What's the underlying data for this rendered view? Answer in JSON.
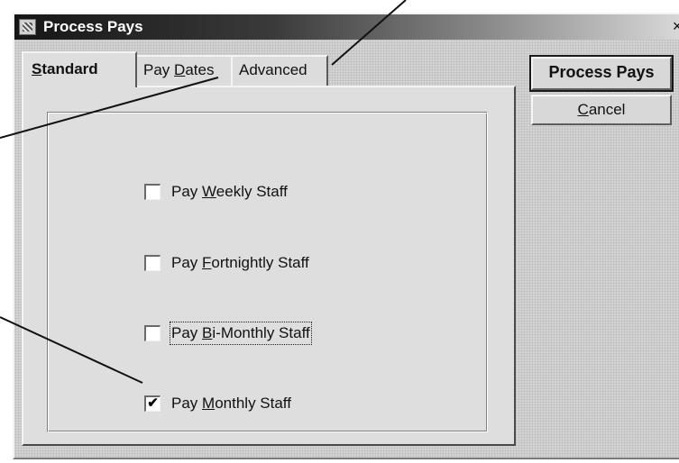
{
  "window": {
    "title": "Process Pays",
    "close_glyph": "×",
    "icon": "app-icon"
  },
  "tabs": [
    {
      "label": "Standard",
      "accel": "S",
      "rest": "tandard",
      "selected": true
    },
    {
      "label": "Pay Dates",
      "pre": "Pay ",
      "accel": "D",
      "rest": "ates",
      "selected": false
    },
    {
      "label": "Advanced",
      "selected": false
    }
  ],
  "options": [
    {
      "pre": "Pay ",
      "accel": "W",
      "rest": "eekly Staff",
      "checked": false
    },
    {
      "pre": "Pay ",
      "accel": "F",
      "rest": "ortnightly Staff",
      "checked": false
    },
    {
      "pre": "Pay ",
      "accel": "B",
      "rest": "i-Monthly Staff",
      "checked": false,
      "focused": true
    },
    {
      "pre": "Pay ",
      "accel": "M",
      "rest": "onthly Staff",
      "checked": true
    }
  ],
  "check_glyph": "✔",
  "buttons": {
    "process": "Process Pays",
    "cancel_accel": "C",
    "cancel_rest": "ancel"
  }
}
